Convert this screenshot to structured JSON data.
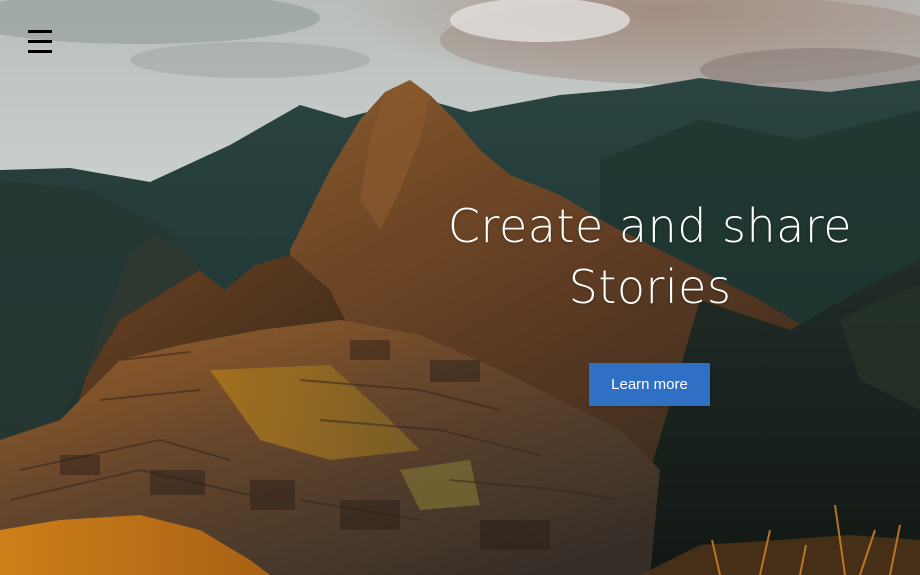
{
  "header": {
    "menu_icon": "hamburger-menu-icon"
  },
  "hero": {
    "background": "mountain-ruins-landscape-photo",
    "title_line1": "Create and share",
    "title_line2": "Stories",
    "button_label": "Learn more"
  },
  "colors": {
    "button_bg": "#2f6fc4",
    "title_text": "#ffffff",
    "menu_icon": "#000000"
  }
}
